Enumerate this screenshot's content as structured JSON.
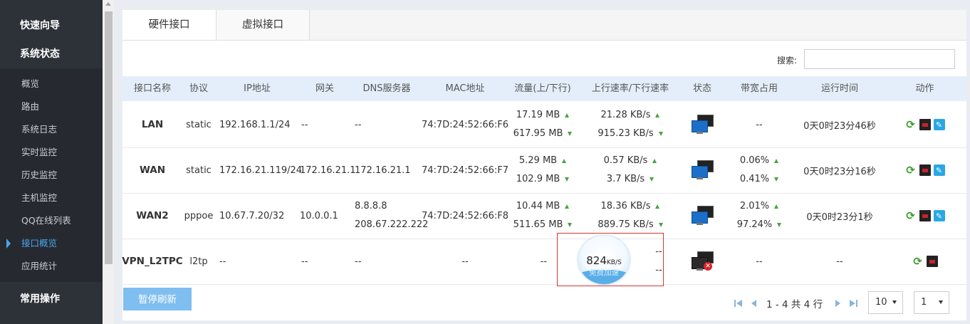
{
  "sidebar": {
    "groups": [
      {
        "label": "快速向导"
      },
      {
        "label": "系统状态"
      },
      {
        "label": "常用操作"
      }
    ],
    "items": [
      {
        "label": "概览"
      },
      {
        "label": "路由"
      },
      {
        "label": "系统日志"
      },
      {
        "label": "实时监控"
      },
      {
        "label": "历史监控"
      },
      {
        "label": "主机监控"
      },
      {
        "label": "QQ在线列表"
      },
      {
        "label": "接口概览"
      },
      {
        "label": "应用统计"
      }
    ],
    "active_item": "接口概览"
  },
  "tabs": [
    {
      "label": "硬件接口"
    },
    {
      "label": "虚拟接口"
    }
  ],
  "search": {
    "label": "搜索:",
    "value": ""
  },
  "table": {
    "headers": [
      "接口名称",
      "协议",
      "IP地址",
      "网关",
      "DNS服务器",
      "MAC地址",
      "流量(上/下行)",
      "上行速率/下行速率",
      "状态",
      "带宽占用",
      "运行时间",
      "动作"
    ],
    "rows": [
      {
        "name": "LAN",
        "protocol": "static",
        "ip": "192.168.1.1/24",
        "gateway": "--",
        "dns": [
          "--"
        ],
        "mac": "74:7D:24:52:66:F6",
        "traffic_up": "17.19 MB",
        "traffic_down": "617.95 MB",
        "rate_up": "21.28 KB/s",
        "rate_down": "915.23 KB/s",
        "status": "connected",
        "bandwidth": [
          "--"
        ],
        "uptime": "0天0时23分46秒",
        "actions": [
          "refresh-icon",
          "disconnect-icon",
          "edit-icon"
        ]
      },
      {
        "name": "WAN",
        "protocol": "static",
        "ip": "172.16.21.119/24",
        "gateway": "172.16.21.1",
        "dns": [
          "172.16.21.1"
        ],
        "mac": "74:7D:24:52:66:F7",
        "traffic_up": "5.29 MB",
        "traffic_down": "102.9 MB",
        "rate_up": "0.57 KB/s",
        "rate_down": "3.7 KB/s",
        "status": "connected",
        "bandwidth": [
          "0.06%",
          "0.41%"
        ],
        "uptime": "0天0时23分16秒",
        "actions": [
          "refresh-icon",
          "disconnect-icon",
          "edit-icon"
        ]
      },
      {
        "name": "WAN2",
        "protocol": "pppoe",
        "ip": "10.67.7.20/32",
        "gateway": "10.0.0.1",
        "dns": [
          "8.8.8.8",
          "208.67.222.222"
        ],
        "mac": "74:7D:24:52:66:F8",
        "traffic_up": "10.44 MB",
        "traffic_down": "511.65 MB",
        "rate_up": "18.36 KB/s",
        "rate_down": "889.75 KB/s",
        "status": "connected",
        "bandwidth": [
          "2.01%",
          "97.24%"
        ],
        "uptime": "0天0时23分1秒",
        "actions": [
          "refresh-icon",
          "disconnect-icon",
          "edit-icon"
        ]
      },
      {
        "name": "VPN_L2TPC",
        "protocol": "l2tp",
        "ip": "--",
        "gateway": "--",
        "dns": [
          "--"
        ],
        "mac": "--",
        "traffic": "--",
        "rate_up": "--",
        "rate_down": "--",
        "status": "disconnected",
        "bandwidth": [
          "--"
        ],
        "uptime": "--",
        "actions": [
          "refresh-icon",
          "disconnect-icon"
        ]
      }
    ]
  },
  "buttons": {
    "pause": "暂停刷新"
  },
  "pager": {
    "summary": "1 - 4 共 4 行",
    "page_size": "10",
    "page": "1"
  },
  "speed_widget": {
    "value": "824",
    "unit": "KB/S",
    "label": "免费加速"
  },
  "colors": {
    "accent": "#4aa5ee",
    "sidebar_bg": "#2d3238",
    "header_bg": "#e4eefa",
    "arrow": "#46a340",
    "overlay_border": "#d9362f"
  }
}
